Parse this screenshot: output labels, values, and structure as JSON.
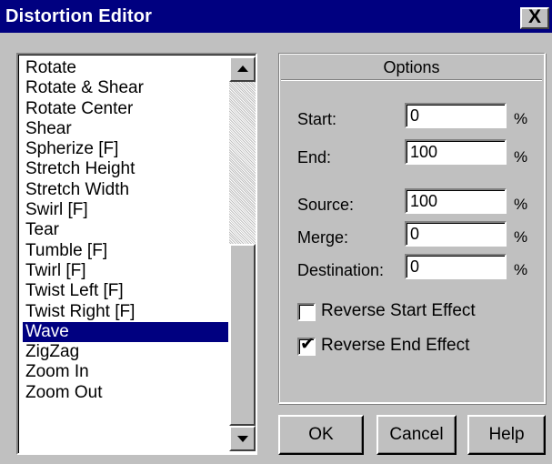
{
  "window": {
    "title": "Distortion Editor",
    "close_label": "X"
  },
  "list": {
    "items": [
      "Rotate",
      "Rotate & Shear",
      "Rotate Center",
      "Shear",
      "Spherize [F]",
      "Stretch Height",
      "Stretch Width",
      "Swirl [F]",
      "Tear",
      "Tumble [F]",
      "Twirl [F]",
      "Twist Left [F]",
      "Twist Right [F]",
      "Wave",
      "ZigZag",
      "Zoom In",
      "Zoom Out"
    ],
    "selected_item": "Wave"
  },
  "options": {
    "header": "Options",
    "start_label": "Start:",
    "start_value": "0",
    "end_label": "End:",
    "end_value": "100",
    "source_label": "Source:",
    "source_value": "100",
    "merge_label": "Merge:",
    "merge_value": "0",
    "destination_label": "Destination:",
    "destination_value": "0",
    "percent": "%",
    "reverse_start_label": "Reverse Start Effect",
    "reverse_start_checked": false,
    "reverse_end_label": "Reverse End Effect",
    "reverse_end_checked": true,
    "check_glyph": "✔"
  },
  "buttons": {
    "ok": "OK",
    "cancel": "Cancel",
    "help": "Help"
  },
  "colors": {
    "title_bar": "#000080",
    "selection": "#000080",
    "face": "#c0c0c0"
  }
}
